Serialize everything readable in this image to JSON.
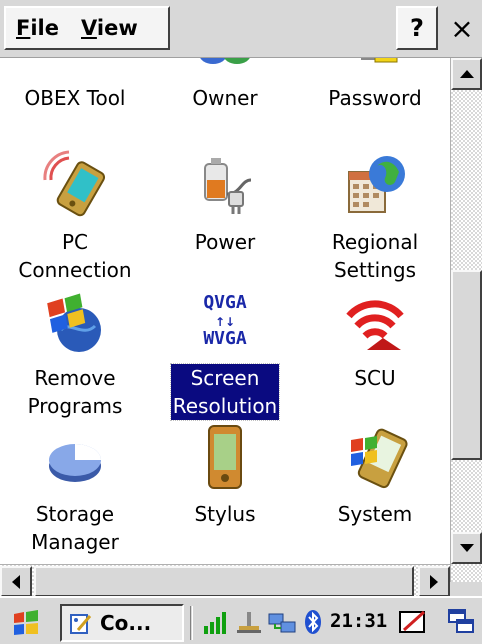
{
  "menubar": {
    "file": "File",
    "file_rest": "ile",
    "view": "View",
    "view_rest": "iew",
    "help": "?",
    "close": "×"
  },
  "items": [
    {
      "label": "OBEX Tool",
      "icon": "obex-icon"
    },
    {
      "label": "Owner",
      "icon": "owner-icon"
    },
    {
      "label": "Password",
      "icon": "password-icon"
    },
    {
      "label": "PC\nConnection",
      "icon": "pc-connection-icon"
    },
    {
      "label": "Power",
      "icon": "power-icon"
    },
    {
      "label": "Regional\nSettings",
      "icon": "regional-settings-icon"
    },
    {
      "label": "Remove\nPrograms",
      "icon": "remove-programs-icon"
    },
    {
      "label": "Screen\nResolution",
      "icon": "screen-resolution-icon",
      "selected": true
    },
    {
      "label": "SCU",
      "icon": "scu-icon"
    },
    {
      "label": "Storage\nManager",
      "icon": "storage-manager-icon"
    },
    {
      "label": "Stylus",
      "icon": "stylus-icon"
    },
    {
      "label": "System",
      "icon": "system-icon"
    }
  ],
  "screen_resolution_icon_text": {
    "top": "QVGA",
    "arrows": "↑↓",
    "bottom": "WVGA"
  },
  "taskbar": {
    "task_label": "Co...",
    "clock": "21:31"
  },
  "colors": {
    "selection": "#0a0a80",
    "chrome": "#d8d8d8"
  }
}
